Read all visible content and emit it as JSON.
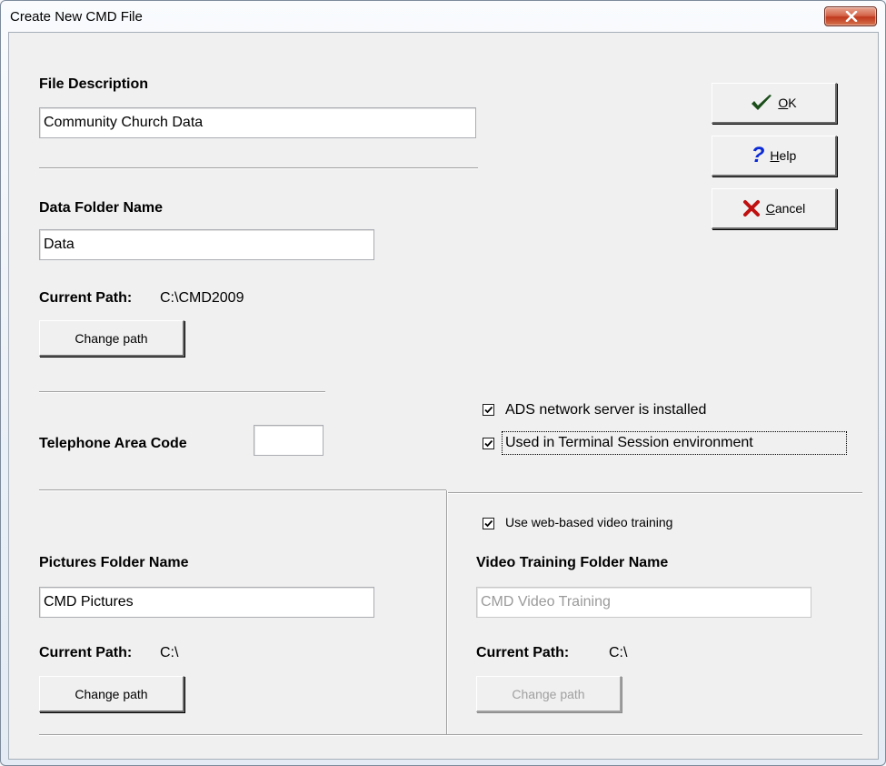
{
  "window": {
    "title": "Create New CMD File"
  },
  "file_description": {
    "label": "File Description",
    "value": "Community Church Data"
  },
  "data_folder": {
    "label": "Data Folder Name",
    "value": "Data",
    "current_path_label": "Current Path:",
    "current_path_value": "C:\\CMD2009",
    "change_path_label": "Change path"
  },
  "telephone": {
    "label": "Telephone Area Code",
    "value": ""
  },
  "options": {
    "ads_label": "ADS network server is installed",
    "ads_checked": true,
    "terminal_label": "Used in Terminal Session environment",
    "terminal_checked": true,
    "video_label": "Use web-based video training",
    "video_checked": true
  },
  "pictures_folder": {
    "label": "Pictures Folder Name",
    "value": "CMD Pictures",
    "current_path_label": "Current Path:",
    "current_path_value": "C:\\",
    "change_path_label": "Change path"
  },
  "video_folder": {
    "label": "Video Training Folder Name",
    "value": "CMD Video Training",
    "current_path_label": "Current Path:",
    "current_path_value": "C:\\",
    "change_path_label": "Change path"
  },
  "buttons": {
    "ok_label": "K",
    "ok_mnemonic": "O",
    "help_label": "elp",
    "help_mnemonic": "H",
    "cancel_label": "ancel",
    "cancel_mnemonic": "C"
  },
  "colors": {
    "ok_icon": "#1a4d1a",
    "help_icon": "#0a2ad8",
    "cancel_icon": "#c01010",
    "close_button": "#c0391e"
  }
}
